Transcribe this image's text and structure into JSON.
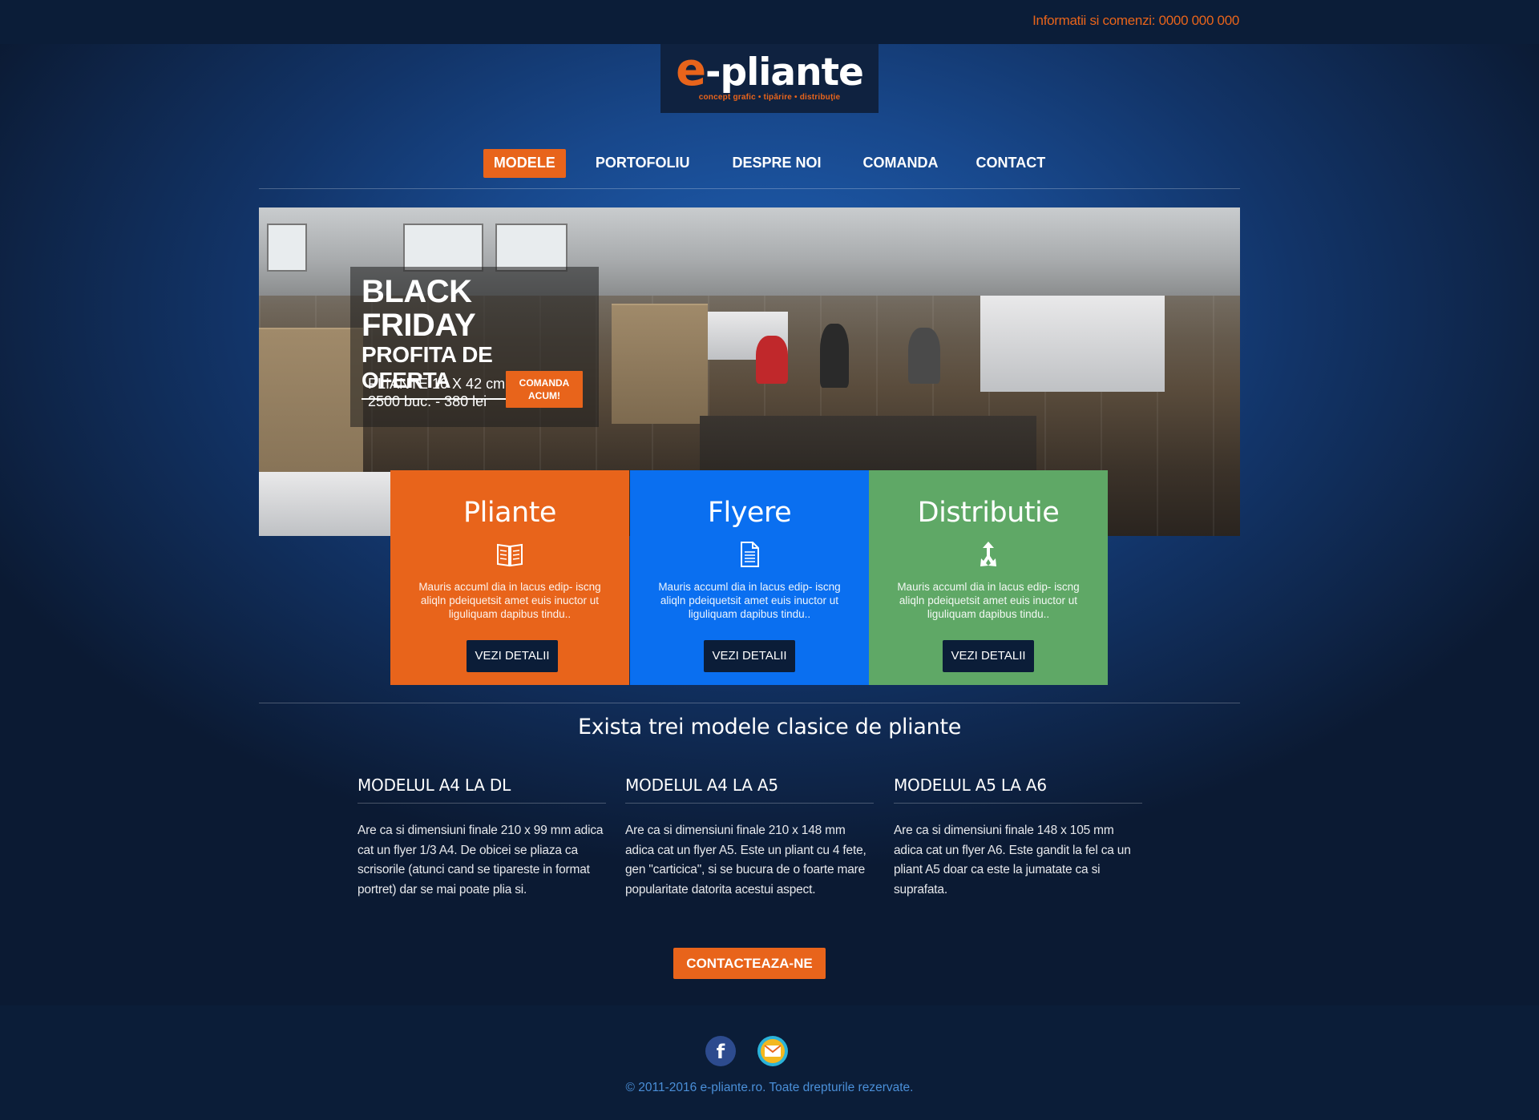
{
  "topbar": {
    "info": "Informatii si comenzi: 0000 000 000"
  },
  "logo": {
    "e": "e",
    "rest": "-pliante",
    "tagline": "concept grafic  •  tipărire  •  distribuţie"
  },
  "nav": {
    "items": [
      {
        "label": "MODELE",
        "active": true
      },
      {
        "label": "PORTOFOLIU"
      },
      {
        "label": "DESPRE NOI"
      },
      {
        "label": "COMANDA"
      },
      {
        "label": "CONTACT"
      }
    ]
  },
  "hero": {
    "title": "BLACK FRIDAY",
    "subtitle": "PROFITA DE OFERTA",
    "detail_line1": "PLIANTE 10 X 42 cm",
    "detail_line2": "2500 buc. - 380 lei",
    "button_line1": "COMANDA",
    "button_line2": "ACUM!"
  },
  "cards": [
    {
      "title": "Pliante",
      "icon": "book-icon",
      "text": "Mauris accuml dia in lacus edip- iscng aliqln pdeiquetsit amet euis inuctor ut liguliquam dapibus tindu..",
      "button": "VEZI DETALII",
      "color": "#e8641b"
    },
    {
      "title": "Flyere",
      "icon": "document-icon",
      "text": "Mauris accuml dia in lacus edip- iscng aliqln pdeiquetsit amet euis inuctor ut liguliquam dapibus tindu..",
      "button": "VEZI DETALII",
      "color": "#0a6ff0"
    },
    {
      "title": "Distributie",
      "icon": "directions-icon",
      "text": "Mauris accuml dia in lacus edip- iscng aliqln pdeiquetsit amet euis inuctor ut liguliquam dapibus tindu..",
      "button": "VEZI DETALII",
      "color": "#5fa866"
    }
  ],
  "models": {
    "title": "Exista trei modele clasice de pliante",
    "columns": [
      {
        "title": "MODELUL A4 LA DL",
        "text": "Are ca si dimensiuni finale 210 x 99 mm adica cat un flyer 1/3 A4. De obicei se pliaza ca scrisorile (atunci cand se tipareste in format portret) dar se mai poate plia si."
      },
      {
        "title": "MODELUL A4 LA A5",
        "text": "Are ca si dimensiuni finale 210 x 148 mm adica cat un flyer A5. Este un pliant cu 4 fete, gen \"carticica\", si se bucura de o foarte mare popularitate datorita acestui aspect."
      },
      {
        "title": "MODELUL A5 LA A6",
        "text": "Are ca si dimensiuni finale 148 x 105 mm adica cat un flyer A6. Este gandit la fel ca un pliant A5 doar ca este la jumatate ca si suprafata."
      }
    ]
  },
  "cta": {
    "label": "CONTACTEAZA-NE"
  },
  "footer": {
    "facebook": "f",
    "copyright": "© 2011-2016 e-pliante.ro. Toate drepturile rezervate."
  },
  "colors": {
    "accent": "#e8641b",
    "blue": "#0a6ff0",
    "green": "#5fa866",
    "navy": "#0b1d38"
  }
}
